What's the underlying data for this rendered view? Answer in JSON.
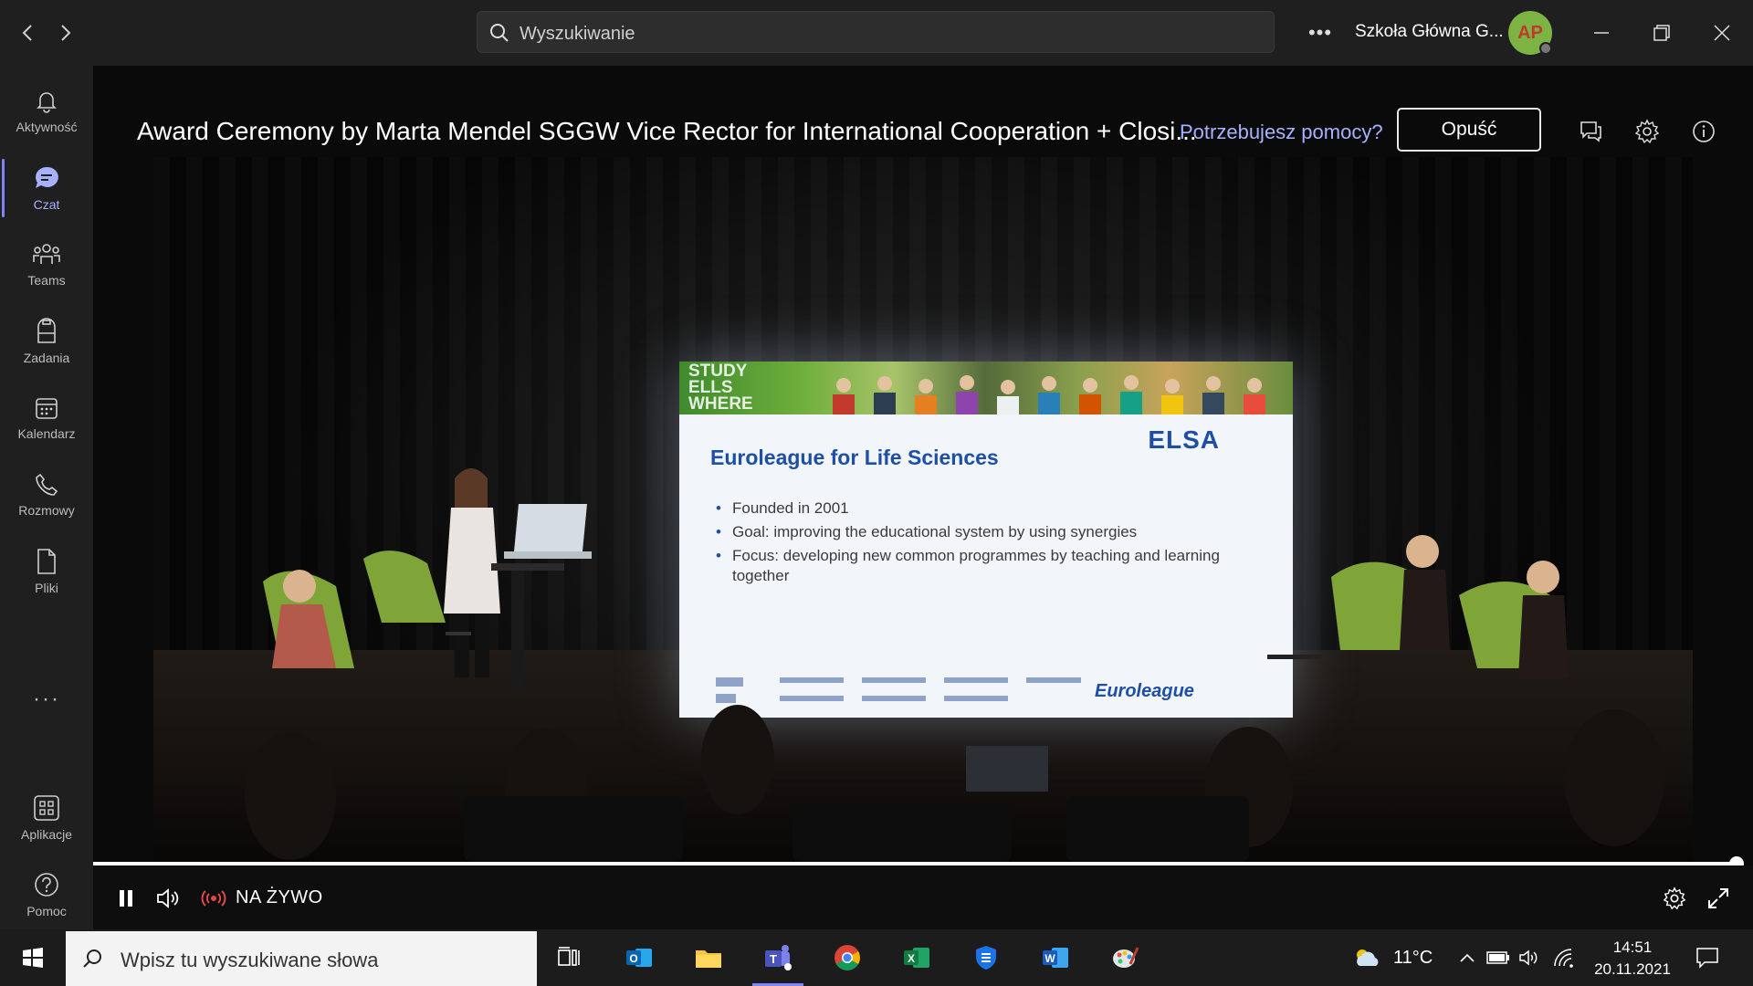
{
  "titlebar": {
    "search_placeholder": "Wyszukiwanie",
    "org_name": "Szkoła Główna G...",
    "avatar_initials": "AP"
  },
  "rail": {
    "items": [
      {
        "label": "Aktywność",
        "icon": "bell-icon"
      },
      {
        "label": "Czat",
        "icon": "chat-icon"
      },
      {
        "label": "Teams",
        "icon": "teams-icon"
      },
      {
        "label": "Zadania",
        "icon": "assignments-icon"
      },
      {
        "label": "Kalendarz",
        "icon": "calendar-icon"
      },
      {
        "label": "Rozmowy",
        "icon": "phone-icon"
      },
      {
        "label": "Pliki",
        "icon": "file-icon"
      }
    ],
    "more": "···",
    "apps_label": "Aplikacje",
    "help_label": "Pomoc"
  },
  "event": {
    "title": "Award Ceremony by Marta Mendel SGGW Vice Rector for International Cooperation + Closi...",
    "help_link": "Potrzebujesz pomocy?",
    "leave_label": "Opuść"
  },
  "slide": {
    "banner_text": [
      "STUDY",
      "ELLS",
      "WHERE"
    ],
    "logo": "ELSA",
    "heading": "Euroleague for Life Sciences",
    "bullets": [
      "Founded in 2001",
      "Goal: improving the educational system by using synergies",
      "Focus: developing new common programmes by teaching and learning together"
    ],
    "footer_brand": "Euroleague"
  },
  "player": {
    "live_label": "NA ŻYWO",
    "progress": 1.0
  },
  "taskbar": {
    "search_placeholder": "Wpisz tu wyszukiwane słowa",
    "temperature": "11°C",
    "time": "14:51",
    "date": "20.11.2021"
  },
  "colors": {
    "accent": "#7f85f5",
    "link": "#a8b1ff",
    "chrome_bg": "#1f1f1f",
    "slide_blue": "#1e4fa8"
  }
}
